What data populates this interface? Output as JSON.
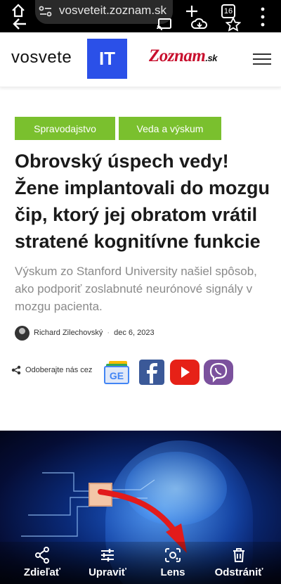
{
  "browser": {
    "url": "vosveteit.zoznam.sk",
    "tab_count": "16"
  },
  "header": {
    "logo_text": "vosvete",
    "logo_box": "IT",
    "partner_logo": "Zoznam",
    "partner_logo_suffix": ".sk"
  },
  "tags": [
    "Spravodajstvo",
    "Veda a výskum"
  ],
  "article": {
    "title": "Obrovský úspech vedy! Žene implantovali do mozgu čip, ktorý jej obratom vrátil stratené kognitívne funkcie",
    "subtitle": "Výskum zo Stanford University našiel spôsob, ako podporiť zoslabnuté neurónové signály v mozgu pacienta.",
    "author": "Richard Zilechovský",
    "date": "dec 6, 2023"
  },
  "share": {
    "label": "Odoberajte nás cez",
    "gnews_text": "GE"
  },
  "actions": {
    "share": "Zdieľať",
    "edit": "Upraviť",
    "lens": "Lens",
    "delete": "Odstrániť"
  },
  "colors": {
    "tag_green": "#7ac02e",
    "logo_blue": "#2b50e8",
    "zoznam_red": "#c8102e",
    "facebook": "#3b5998",
    "youtube": "#e62117",
    "viber": "#7b519d"
  },
  "icons": [
    "home-icon",
    "back-icon",
    "site-settings-icon",
    "cast-icon",
    "add-tab-icon",
    "cloud-download-icon",
    "tabs-icon",
    "star-icon",
    "more-icon",
    "menu-icon",
    "share-icon",
    "edit-icon",
    "lens-icon",
    "delete-icon"
  ]
}
